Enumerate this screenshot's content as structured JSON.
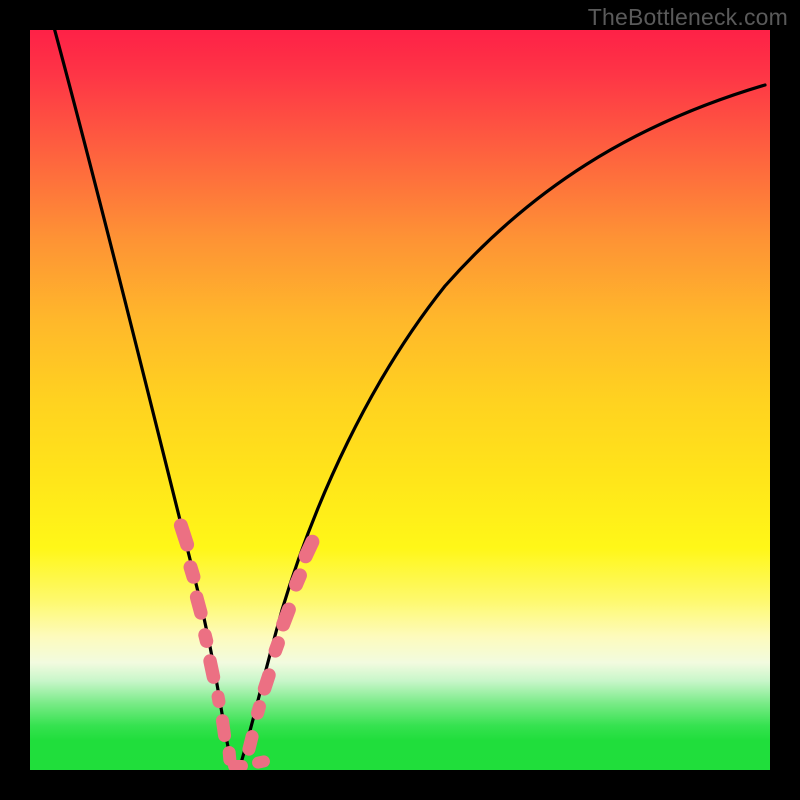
{
  "watermark": {
    "text": "TheBottleneck.com"
  },
  "chart_data": {
    "type": "line",
    "title": "",
    "xlabel": "",
    "ylabel": "",
    "xlim": [
      0,
      100
    ],
    "ylim": [
      0,
      100
    ],
    "notes": "V-shaped bottleneck curve over red-yellow-green vertical gradient. Minimum near x≈25, y≈0. Rounded dashed segments on the lower portion of both arms.",
    "series": [
      {
        "name": "curve",
        "x": [
          3,
          5,
          8,
          11,
          14,
          17,
          20,
          22,
          24,
          25,
          26,
          28,
          31,
          35,
          40,
          46,
          53,
          62,
          72,
          84,
          97
        ],
        "y": [
          100,
          88,
          73,
          59,
          46,
          34,
          22,
          13,
          5,
          1,
          2,
          6,
          14,
          25,
          37,
          49,
          60,
          70,
          79,
          86,
          92
        ]
      }
    ],
    "dash_clusters": {
      "left_arm": {
        "x_range": [
          17,
          25
        ],
        "approx_y_range": [
          1,
          34
        ]
      },
      "right_arm": {
        "x_range": [
          25,
          35
        ],
        "approx_y_range": [
          1,
          27
        ]
      }
    },
    "gradient_stops": [
      {
        "pos": 0.0,
        "color": "#fe2147"
      },
      {
        "pos": 0.5,
        "color": "#ffd220"
      },
      {
        "pos": 0.82,
        "color": "#fdfbbd"
      },
      {
        "pos": 0.94,
        "color": "#36e250"
      },
      {
        "pos": 1.0,
        "color": "#20de3b"
      }
    ],
    "colors": {
      "curve": "#000000",
      "dash": "#ec7083",
      "frame": "#000000"
    }
  }
}
